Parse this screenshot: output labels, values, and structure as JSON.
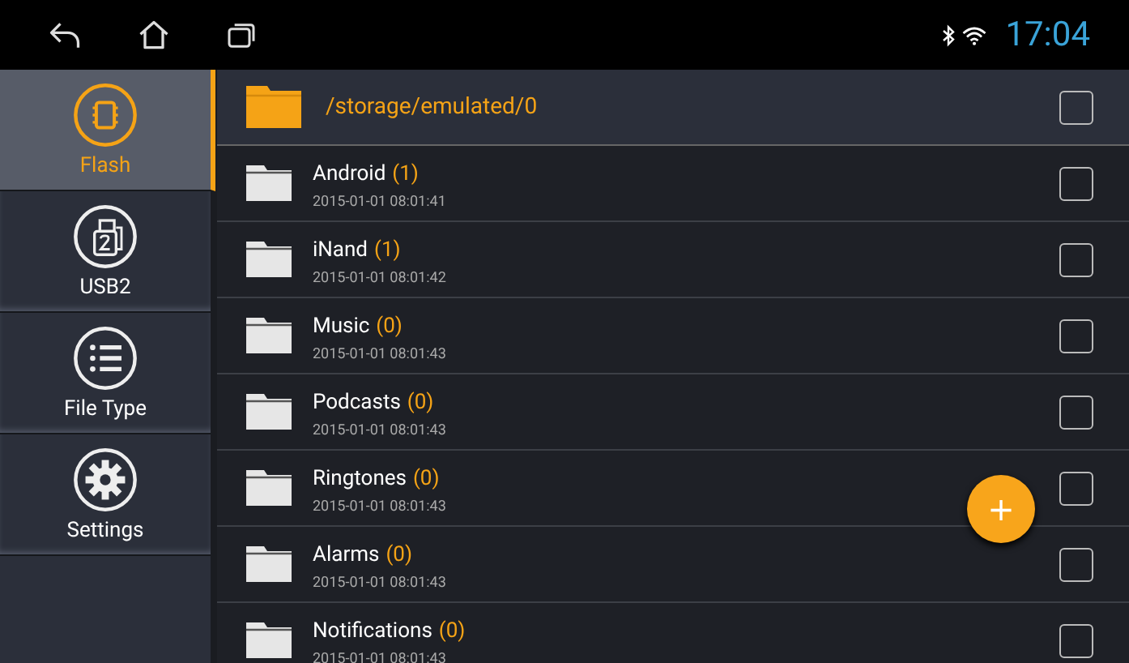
{
  "status_bar": {
    "time": "17:04"
  },
  "sidebar": {
    "items": [
      {
        "label": "Flash",
        "kind": "flash",
        "selected": true
      },
      {
        "label": "USB2",
        "kind": "usb",
        "selected": false
      },
      {
        "label": "File Type",
        "kind": "list",
        "selected": false
      },
      {
        "label": "Settings",
        "kind": "settings",
        "selected": false
      }
    ]
  },
  "current_path": {
    "path": "/storage/emulated/0",
    "checked": false
  },
  "folders": [
    {
      "name": "Android",
      "count": "(1)",
      "date": "2015-01-01 08:01:41",
      "checked": false
    },
    {
      "name": "iNand",
      "count": "(1)",
      "date": "2015-01-01 08:01:42",
      "checked": false
    },
    {
      "name": "Music",
      "count": "(0)",
      "date": "2015-01-01 08:01:43",
      "checked": false
    },
    {
      "name": "Podcasts",
      "count": "(0)",
      "date": "2015-01-01 08:01:43",
      "checked": false
    },
    {
      "name": "Ringtones",
      "count": "(0)",
      "date": "2015-01-01 08:01:43",
      "checked": false
    },
    {
      "name": "Alarms",
      "count": "(0)",
      "date": "2015-01-01 08:01:43",
      "checked": false
    },
    {
      "name": "Notifications",
      "count": "(0)",
      "date": "2015-01-01 08:01:43",
      "checked": false
    }
  ],
  "fab": {
    "label": "+"
  }
}
